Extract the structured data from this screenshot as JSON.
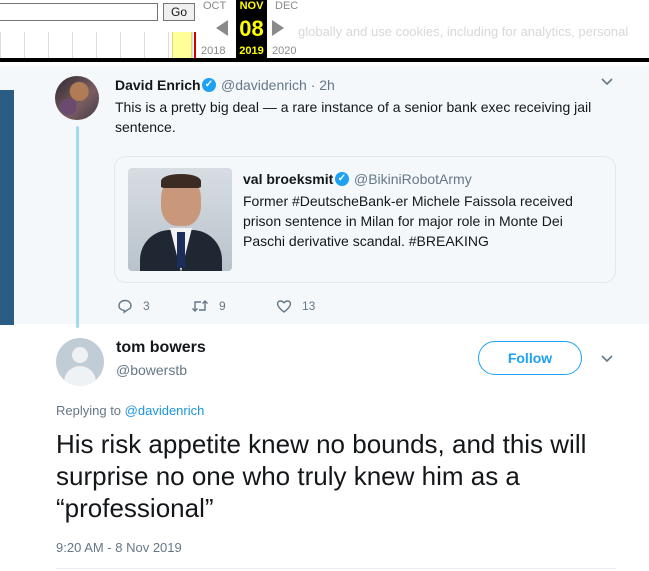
{
  "wayback": {
    "go_label": "Go",
    "months": {
      "prev": "OCT",
      "current": "NOV",
      "next": "DEC"
    },
    "day": "08",
    "years": {
      "prev": "2018",
      "current": "2019",
      "next": "2020"
    },
    "background_text": "globally and use cookies, including for analytics, personal"
  },
  "quoted_tweet": {
    "author_name": "David Enrich",
    "author_handle": "@davidenrich",
    "age": "· 2h",
    "text": "This is a pretty big deal — a rare instance of a senior bank exec receiving jail sentence.",
    "embedded": {
      "author_name": "val broeksmit",
      "author_handle": "@BikiniRobotArmy",
      "text": "Former #DeutscheBank-er Michele Faissola received prison sentence in Milan for major role in Monte Dei Paschi derivative scandal. #BREAKING"
    },
    "actions": {
      "replies": "3",
      "retweets": "9",
      "likes": "13"
    }
  },
  "main_tweet": {
    "author_name": "tom bowers",
    "author_handle": "@bowerstb",
    "follow_label": "Follow",
    "replying_prefix": "Replying to",
    "replying_handle": "@davidenrich",
    "text": "His risk appetite knew no bounds, and this will surprise no one who truly knew him as a “professional”",
    "timestamp": "9:20 AM - 8 Nov 2019"
  },
  "colors": {
    "accent": "#1da1f2",
    "secondary_text": "#657786",
    "thread_line": "#a4d9f5",
    "wayback_highlight": "#ffff00"
  }
}
